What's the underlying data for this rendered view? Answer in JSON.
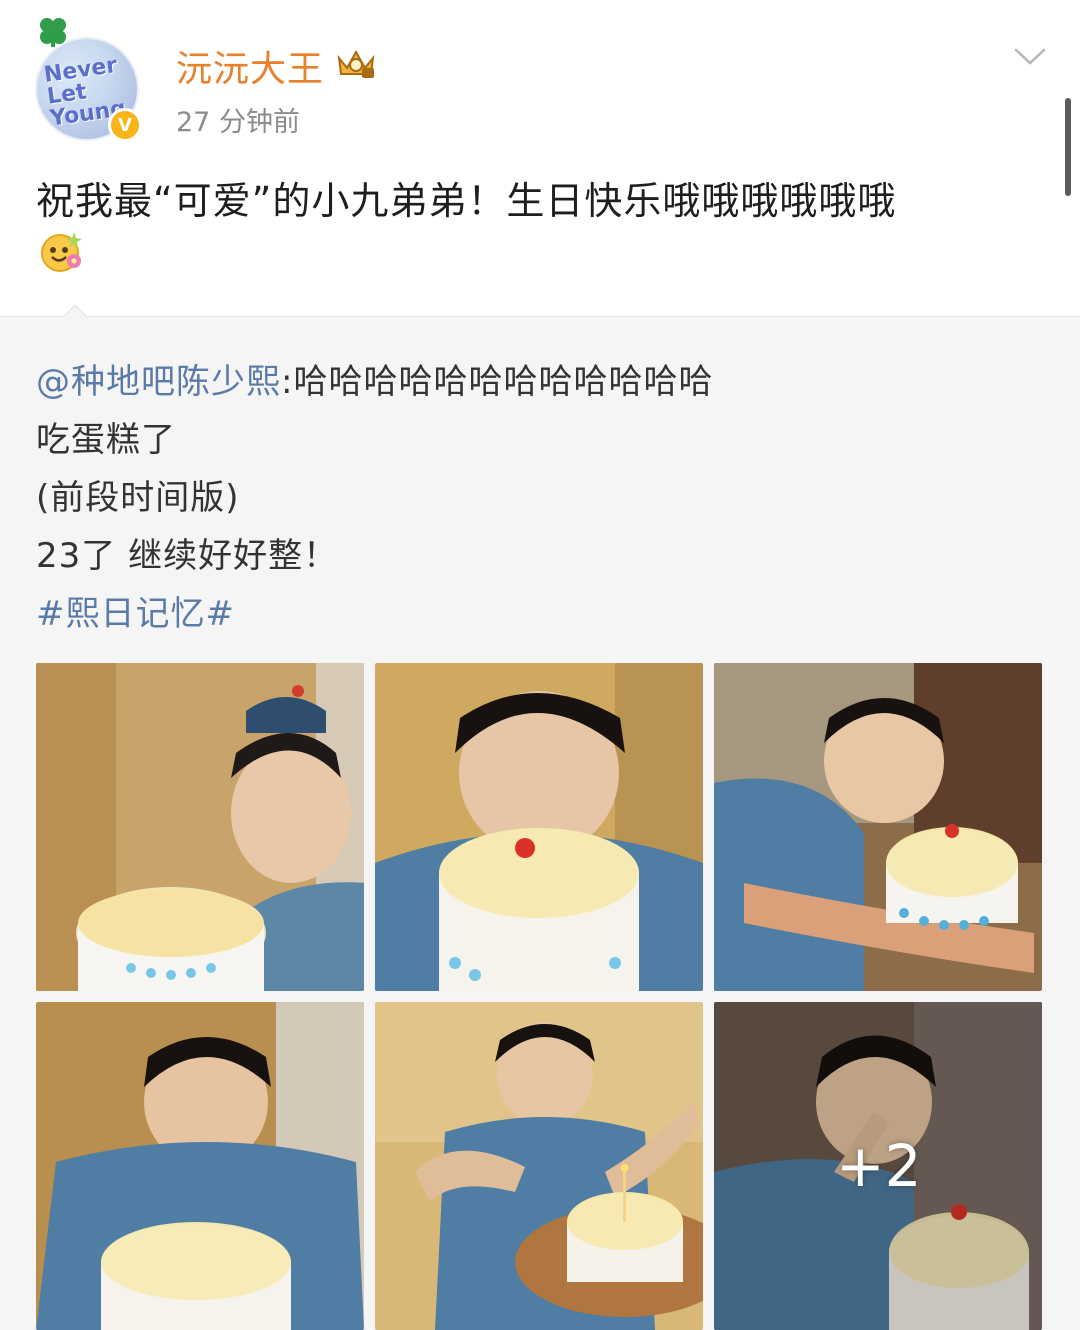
{
  "post": {
    "username": "沅沅大王",
    "timestamp": "27 分钟前",
    "text": "祝我最“可爱”的小九弟弟！生日快乐哦哦哦哦哦哦",
    "avatar_text": "Never Let Young"
  },
  "repost": {
    "mention": "@种地吧陈少熙",
    "first_line_rest": ":哈哈哈哈哈哈哈哈哈哈哈哈",
    "line2": "吃蛋糕了",
    "line3": "(前段时间版)",
    "line4": "23了 继续好好整！",
    "hashtag": "#熙日记忆#"
  },
  "gallery": {
    "more_count": "+2"
  },
  "colors": {
    "username": "#e8812a",
    "link": "#5a7aa7",
    "repost_bg": "#f5f5f5"
  },
  "icons": [
    "clover-icon",
    "verified-icon",
    "vip-crown-icon",
    "chevron-down-icon",
    "smile-flower-emoji"
  ]
}
